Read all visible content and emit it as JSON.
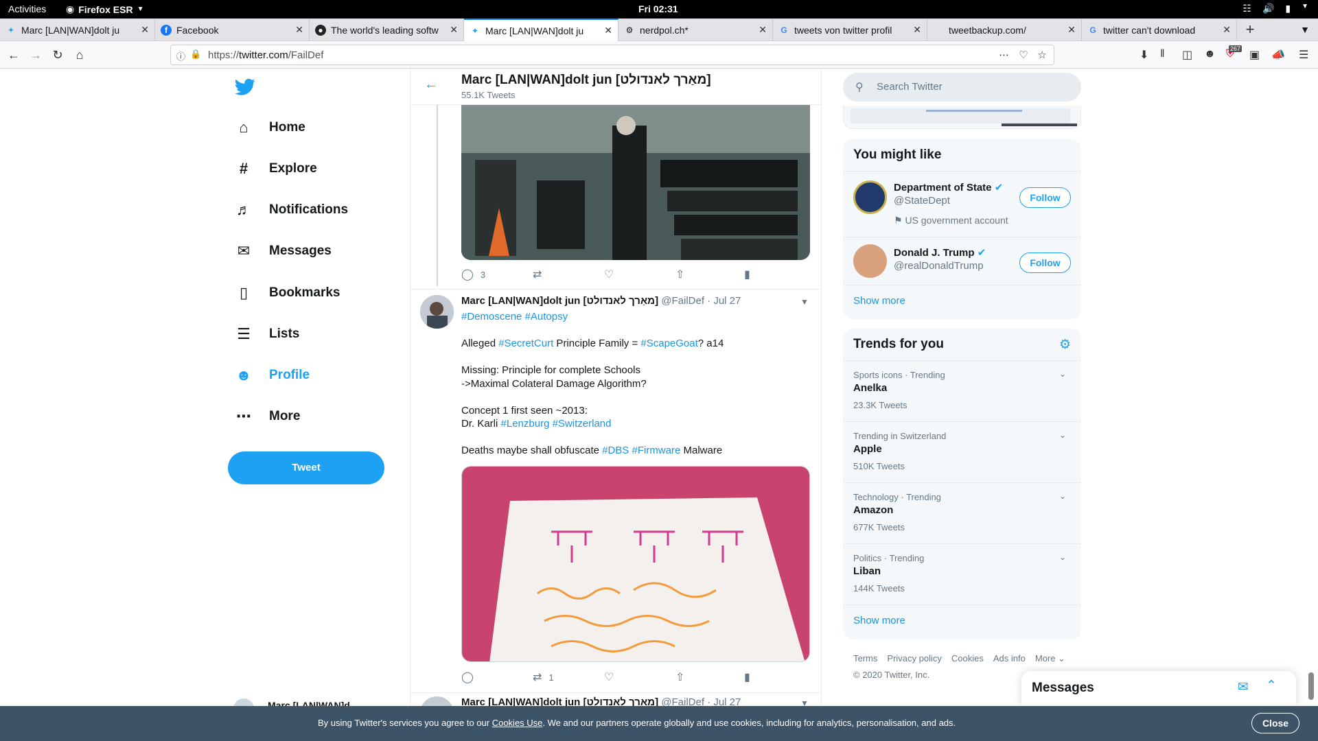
{
  "gnome": {
    "activities": "Activities",
    "app": "Firefox ESR",
    "clock": "Fri 02:31"
  },
  "tabs": [
    {
      "title": "Marc [LAN|WAN]dolt ju"
    },
    {
      "title": "Facebook"
    },
    {
      "title": "The world's leading softw"
    },
    {
      "title": "Marc [LAN|WAN]dolt ju"
    },
    {
      "title": "nerdpol.ch*"
    },
    {
      "title": "tweets von twitter profil"
    },
    {
      "title": "tweetbackup.com/"
    },
    {
      "title": "twitter can't download"
    }
  ],
  "urlbar": {
    "prefix": "https://",
    "host": "twitter.com",
    "path": "/FailDef",
    "badge": "267"
  },
  "nav": {
    "items": [
      {
        "label": "Home",
        "icon": "home-icon"
      },
      {
        "label": "Explore",
        "icon": "hashtag-icon"
      },
      {
        "label": "Notifications",
        "icon": "bell-icon"
      },
      {
        "label": "Messages",
        "icon": "envelope-icon"
      },
      {
        "label": "Bookmarks",
        "icon": "bookmark-icon"
      },
      {
        "label": "Lists",
        "icon": "list-icon"
      },
      {
        "label": "Profile",
        "icon": "person-icon"
      },
      {
        "label": "More",
        "icon": "more-icon"
      }
    ],
    "tweet_button": "Tweet",
    "account_name_partial": "Marc [LAN|WAN]d"
  },
  "header": {
    "name": "Marc [LAN|WAN]dolt jun [מאַרך לאנדולט]",
    "tweets": "55.1K Tweets"
  },
  "tweet1": {
    "replies": "3"
  },
  "tweet2": {
    "name": "Marc [LAN|WAN]dolt jun [מאַרך לאנדולט]",
    "handle": "@FailDef",
    "date": "Jul 27",
    "hashtags_line": [
      "#Demoscene",
      "#Autopsy"
    ],
    "line1_a": "Alleged ",
    "line1_tag1": "#SecretCurt",
    "line1_b": " Principle Family = ",
    "line1_tag2": "#ScapeGoat",
    "line1_c": "? a14",
    "line2": "Missing: Principle for complete Schools",
    "line3": "->Maximal Colateral Damage Algorithm?",
    "line4": "Concept 1 first seen ~2013:",
    "line5_a": "Dr. Karli ",
    "line5_tag1": "#Lenzburg",
    "line5_tag2": "#Switzerland",
    "line6_a": "Deaths maybe shall obfuscate ",
    "line6_tag1": "#DBS",
    "line6_tag2": "#Firmware",
    "line6_b": " Malware",
    "retweets": "1"
  },
  "tweet3": {
    "name": "Marc [LAN|WAN]dolt jun [מאַרך לאנדולט]",
    "handle": "@FailDef",
    "date": "Jul 27"
  },
  "search": {
    "placeholder": "Search Twitter"
  },
  "you_might_like": {
    "title": "You might like",
    "accounts": [
      {
        "name": "Department of State",
        "handle": "@StateDept",
        "label": "US government account",
        "follow": "Follow"
      },
      {
        "name": "Donald J. Trump",
        "handle": "@realDonaldTrump",
        "follow": "Follow"
      }
    ],
    "show_more": "Show more"
  },
  "trends": {
    "title": "Trends for you",
    "items": [
      {
        "context": "Sports icons · Trending",
        "name": "Anelka",
        "count": "23.3K Tweets"
      },
      {
        "context": "Trending in Switzerland",
        "name": "Apple",
        "count": "510K Tweets"
      },
      {
        "context": "Technology · Trending",
        "name": "Amazon",
        "count": "677K Tweets"
      },
      {
        "context": "Politics · Trending",
        "name": "Liban",
        "count": "144K Tweets"
      }
    ],
    "show_more": "Show more"
  },
  "footer": {
    "links": [
      "Terms",
      "Privacy policy",
      "Cookies",
      "Ads info",
      "More"
    ],
    "copyright": "© 2020 Twitter, Inc."
  },
  "messages_drawer": {
    "title": "Messages"
  },
  "cookie": {
    "text_a": "By using Twitter's services you agree to our ",
    "link": "Cookies Use",
    "text_b": ". We and our partners operate globally and use cookies, including for analytics, personalisation, and ads.",
    "close": "Close"
  },
  "colors": {
    "accent": "#1da1f2",
    "link": "#1b95e0",
    "cookie_bar": "#3d5466"
  }
}
